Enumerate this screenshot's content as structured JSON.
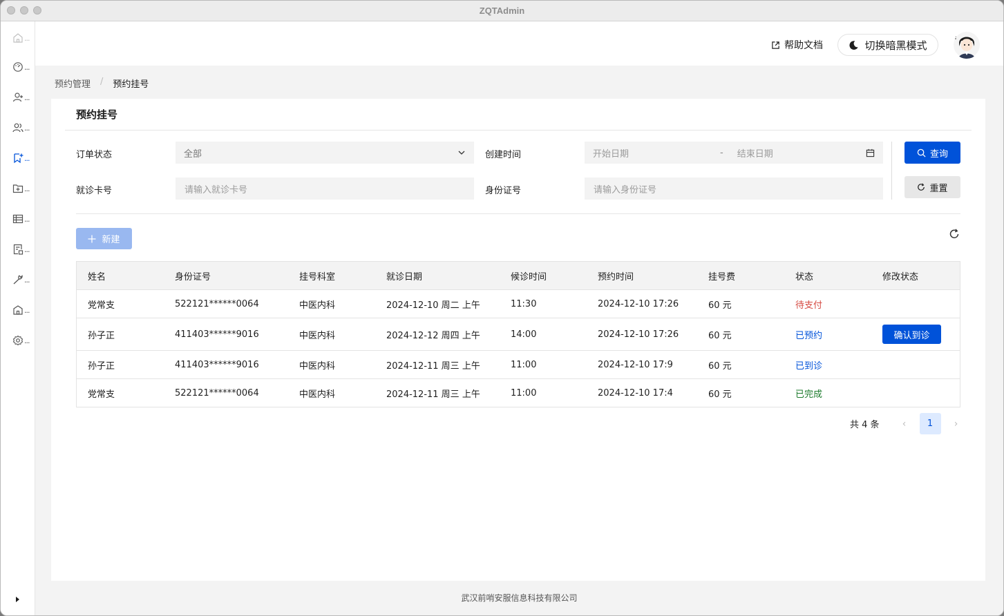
{
  "window": {
    "title": "ZQTAdmin"
  },
  "sidebar": {
    "items": [
      {
        "icon": "home-icon",
        "dots": "..."
      },
      {
        "icon": "dashboard-icon",
        "dots": "..."
      },
      {
        "icon": "user-add-icon",
        "dots": "..."
      },
      {
        "icon": "users-icon",
        "dots": "..."
      },
      {
        "icon": "bookmark-add-icon",
        "dots": "..."
      },
      {
        "icon": "folder-add-icon",
        "dots": "..."
      },
      {
        "icon": "table-icon",
        "dots": "..."
      },
      {
        "icon": "form-icon",
        "dots": "..."
      },
      {
        "icon": "tool-icon",
        "dots": "..."
      },
      {
        "icon": "building-icon",
        "dots": "..."
      },
      {
        "icon": "setting-icon",
        "dots": "..."
      }
    ],
    "active_index": 4
  },
  "topbar": {
    "help_label": "帮助文档",
    "dark_mode_label": "切换暗黑模式"
  },
  "breadcrumb": {
    "parent": "预约管理",
    "separator": "/",
    "current": "预约挂号"
  },
  "card": {
    "title": "预约挂号"
  },
  "filters": {
    "order_status": {
      "label": "订单状态",
      "value": "全部"
    },
    "create_time": {
      "label": "创建时间",
      "start_placeholder": "开始日期",
      "dash": "-",
      "end_placeholder": "结束日期"
    },
    "card_no": {
      "label": "就诊卡号",
      "placeholder": "请输入就诊卡号"
    },
    "id_no": {
      "label": "身份证号",
      "placeholder": "请输入身份证号"
    },
    "query_label": "查询",
    "reset_label": "重置"
  },
  "toolbar": {
    "new_label": "新建"
  },
  "table": {
    "columns": [
      "姓名",
      "身份证号",
      "挂号科室",
      "就诊日期",
      "候诊时间",
      "预约时间",
      "挂号费",
      "状态",
      "修改状态"
    ],
    "rows": [
      {
        "name": "党常支",
        "id": "522121******0064",
        "dept": "中医内科",
        "date": "2024-12-10 周二 上午",
        "wait": "11:30",
        "book": "2024-12-10 17:26",
        "fee": "60 元",
        "status": "待支付",
        "status_color": "#d54941",
        "action": ""
      },
      {
        "name": "孙子正",
        "id": "411403******9016",
        "dept": "中医内科",
        "date": "2024-12-12 周四 上午",
        "wait": "14:00",
        "book": "2024-12-10 17:26",
        "fee": "60 元",
        "status": "已预约",
        "status_color": "#0052d9",
        "action": "确认到诊"
      },
      {
        "name": "孙子正",
        "id": "411403******9016",
        "dept": "中医内科",
        "date": "2024-12-11 周三 上午",
        "wait": "11:00",
        "book": "2024-12-10 17:9",
        "fee": "60 元",
        "status": "已到诊",
        "status_color": "#0052d9",
        "action": ""
      },
      {
        "name": "党常支",
        "id": "522121******0064",
        "dept": "中医内科",
        "date": "2024-12-11 周三 上午",
        "wait": "11:00",
        "book": "2024-12-10 17:4",
        "fee": "60 元",
        "status": "已完成",
        "status_color": "#1b7a2b",
        "action": ""
      }
    ]
  },
  "pagination": {
    "total_label": "共 4 条",
    "current_page": "1",
    "prev": "‹",
    "next": "›"
  },
  "footer": {
    "text": "武汉前哨安服信息科技有限公司"
  },
  "colors": {
    "primary": "#0052d9",
    "danger": "#d54941",
    "success": "#1b7a2b"
  }
}
